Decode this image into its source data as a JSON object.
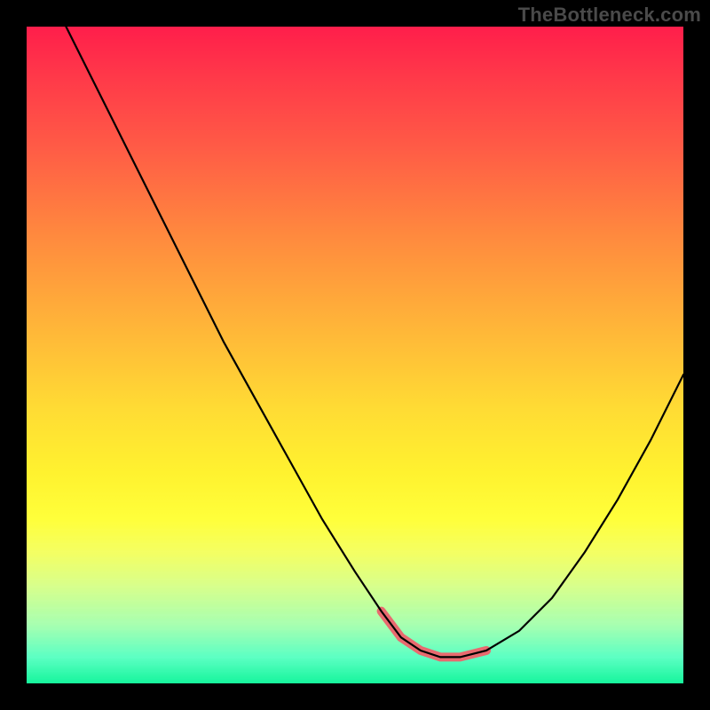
{
  "watermark": "TheBottleneck.com",
  "colors": {
    "frame_bg": "#000000",
    "watermark_text": "#4a4a4a",
    "curve_stroke": "#000000",
    "highlight_stroke": "#e86a6f",
    "gradient_top": "#ff1e4b",
    "gradient_bottom": "#16f59c"
  },
  "chart_data": {
    "type": "line",
    "title": "",
    "xlabel": "",
    "ylabel": "",
    "xlim": [
      0,
      100
    ],
    "ylim": [
      0,
      100
    ],
    "grid": false,
    "legend": false,
    "series": [
      {
        "name": "bottleneck-curve",
        "x": [
          6,
          10,
          15,
          20,
          25,
          30,
          35,
          40,
          45,
          50,
          54,
          57,
          60,
          63,
          66,
          70,
          75,
          80,
          85,
          90,
          95,
          100
        ],
        "values": [
          100,
          92,
          82,
          72,
          62,
          52,
          43,
          34,
          25,
          17,
          11,
          7,
          5,
          4,
          4,
          5,
          8,
          13,
          20,
          28,
          37,
          47
        ]
      }
    ],
    "annotations": [
      {
        "name": "optimal-range-highlight",
        "x_range": [
          54,
          73
        ],
        "y_approx": 5,
        "color": "#e86a6f"
      }
    ],
    "background": {
      "type": "vertical-gradient",
      "meaning": "red-high-bottleneck-to-green-low-bottleneck",
      "stops": [
        {
          "pos": 0.0,
          "color": "#ff1e4b"
        },
        {
          "pos": 0.5,
          "color": "#ffdb34"
        },
        {
          "pos": 0.78,
          "color": "#ffff3a"
        },
        {
          "pos": 1.0,
          "color": "#16f59c"
        }
      ]
    }
  }
}
